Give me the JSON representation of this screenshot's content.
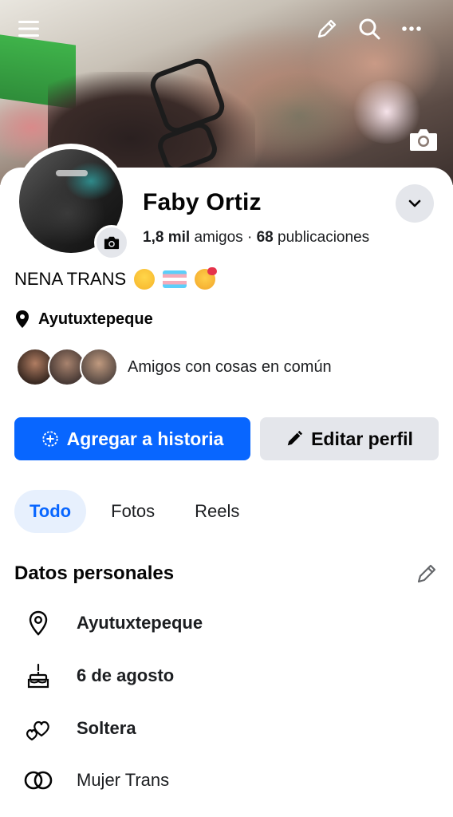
{
  "header": {
    "icons": [
      "menu-icon",
      "pencil-icon",
      "search-icon",
      "more-icon",
      "camera-icon"
    ]
  },
  "profile": {
    "name": "Faby Ortiz",
    "friends_count": "1,8 mil",
    "friends_label": "amigos",
    "separator": "·",
    "posts_count": "68",
    "posts_label": "publicaciones",
    "bio_text": "NENA TRANS",
    "location": "Ayutuxtepeque",
    "mutual_text": "Amigos con cosas en común"
  },
  "actions": {
    "add_story": "Agregar a historia",
    "edit_profile": "Editar perfil"
  },
  "tabs": [
    {
      "label": "Todo",
      "active": true
    },
    {
      "label": "Fotos",
      "active": false
    },
    {
      "label": "Reels",
      "active": false
    }
  ],
  "details": {
    "title": "Datos personales",
    "items": [
      {
        "icon": "location-pin-icon",
        "text": "Ayutuxtepeque"
      },
      {
        "icon": "birthday-cake-icon",
        "text": "6 de agosto"
      },
      {
        "icon": "hearts-icon",
        "text": "Soltera"
      },
      {
        "icon": "rings-icon",
        "text": "Mujer Trans"
      }
    ]
  },
  "colors": {
    "primary": "#0866ff",
    "secondary_bg": "#e4e6eb",
    "active_tab_bg": "#e7f0fd",
    "text": "#050505"
  }
}
